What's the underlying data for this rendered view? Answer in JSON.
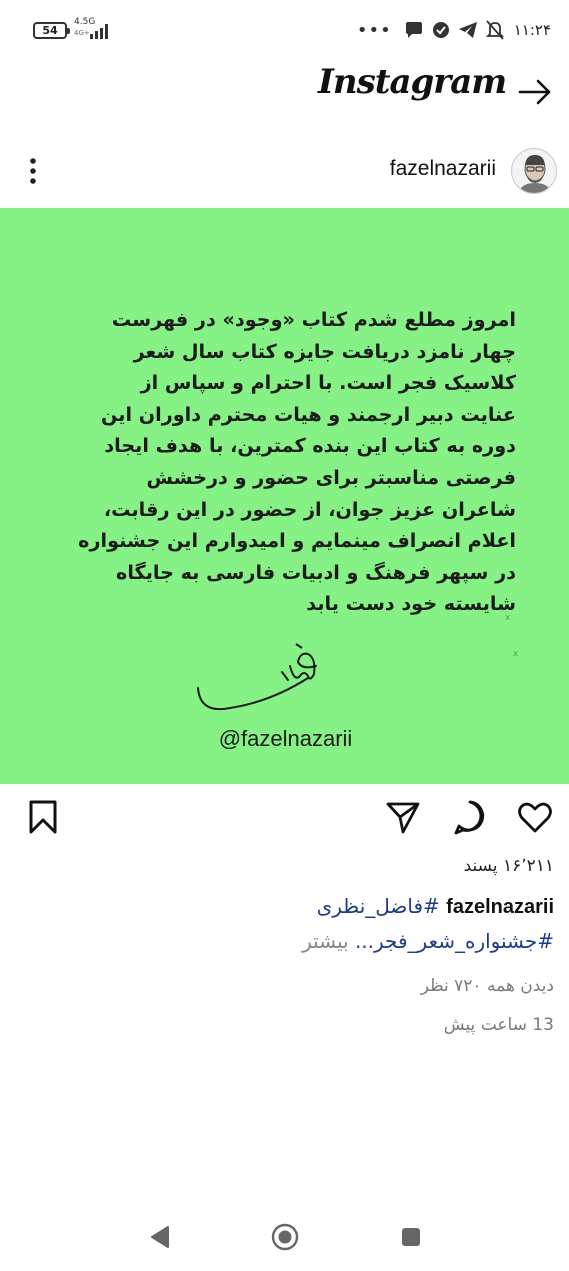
{
  "status_bar": {
    "battery": "54",
    "network": "4.5G",
    "network_sub": "4G+",
    "more": "•••",
    "time": "۱۱:۲۴"
  },
  "header": {
    "logo": "Instagram",
    "forward_icon": "arrow-right-icon"
  },
  "post": {
    "username": "fazelnazarii",
    "image_text": {
      "lines": [
        "امروز مطلع شدم کتاب «وجود» در فهرست",
        "چهار نامزد دریافت جایزه کتاب سال شعر",
        "کلاسیک فجر است. با احترام و سپاس از",
        "عنایت دبیر ارجمند و هیات محترم داوران این",
        "دوره به کتاب این بنده کمترین، با هدف ایجاد",
        "فرصتی مناسبتر برای حضور و درخشش",
        "شاعران عزیز جوان، از حضور در این رقابت،",
        "اعلام انصراف مینمایم و امیدوارم این جشنواره",
        "در سپهر فرهنگ و ادبیات فارسی به جایگاه",
        "شایسته خود دست یابد"
      ],
      "handle": "@fazelnazarii",
      "background": "#86f286"
    },
    "likes": "۱۶٬۲۱۱ پسند",
    "caption_user": "fazelnazarii",
    "caption_tag1": "#فاضل_نظری",
    "caption_tag2": "#جشنواره_شعر_فجر...",
    "caption_more": "بیشتر",
    "views": "دیدن همه ۷۲۰ نظر",
    "time_ago": "13 ساعت پیش"
  },
  "icons": {
    "bookmark": "bookmark-icon",
    "share": "send-icon",
    "comment": "comment-icon",
    "like": "heart-icon"
  }
}
